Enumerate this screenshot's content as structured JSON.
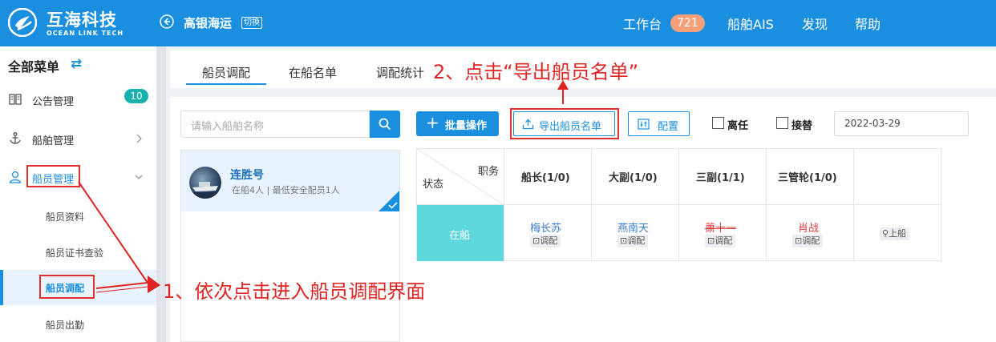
{
  "header": {
    "logo_cn": "互海科技",
    "logo_en": "OCEAN LINK TECH",
    "company": "高银海运",
    "switch_label": "切换",
    "nav": [
      {
        "label": "工作台",
        "badge": "721"
      },
      {
        "label": "船舶AIS"
      },
      {
        "label": "发现"
      },
      {
        "label": "帮助"
      }
    ]
  },
  "sidebar": {
    "title": "全部菜单",
    "items": [
      {
        "label": "公告管理",
        "badge": "10"
      },
      {
        "label": "船舶管理"
      },
      {
        "label": "船员管理"
      }
    ],
    "subitems": [
      "船员资料",
      "船员证书查验",
      "船员调配",
      "船员出勤"
    ]
  },
  "tabs": [
    "船员调配",
    "在船名单",
    "调配统计"
  ],
  "search": {
    "placeholder": "请输入船舶名称"
  },
  "ship": {
    "name": "连胜号",
    "meta": "在船4人 | 最低安全配员1人"
  },
  "toolbar": {
    "batch_label": "批量操作",
    "export_label": "导出船员名单",
    "config_label": "配置",
    "leave_label": "离任",
    "replace_label": "接替",
    "date": "2022-03-29"
  },
  "grid": {
    "corner_top": "职务",
    "corner_bottom": "状态",
    "columns": [
      "船长(1/0)",
      "大副(1/0)",
      "三副(1/1)",
      "三管轮(1/0)"
    ],
    "status": "在船",
    "crew": [
      {
        "name": "梅长苏",
        "color": "#3a7bc8",
        "strike": false
      },
      {
        "name": "燕南天",
        "color": "#3a7bc8",
        "strike": false
      },
      {
        "name": "萧十一",
        "color": "#e04040",
        "strike": true
      },
      {
        "name": "肖战",
        "color": "#e04040",
        "strike": false
      }
    ],
    "adjust_label": "调配",
    "board_label": "上船"
  },
  "annotations": {
    "step1": "1、依次点击进入船员调配界面",
    "step2": "2、点击“导出船员名单”"
  },
  "colors": {
    "brand": "#1a8fe0",
    "accent_red": "#e02424",
    "status_teal": "#5ed8dc"
  }
}
